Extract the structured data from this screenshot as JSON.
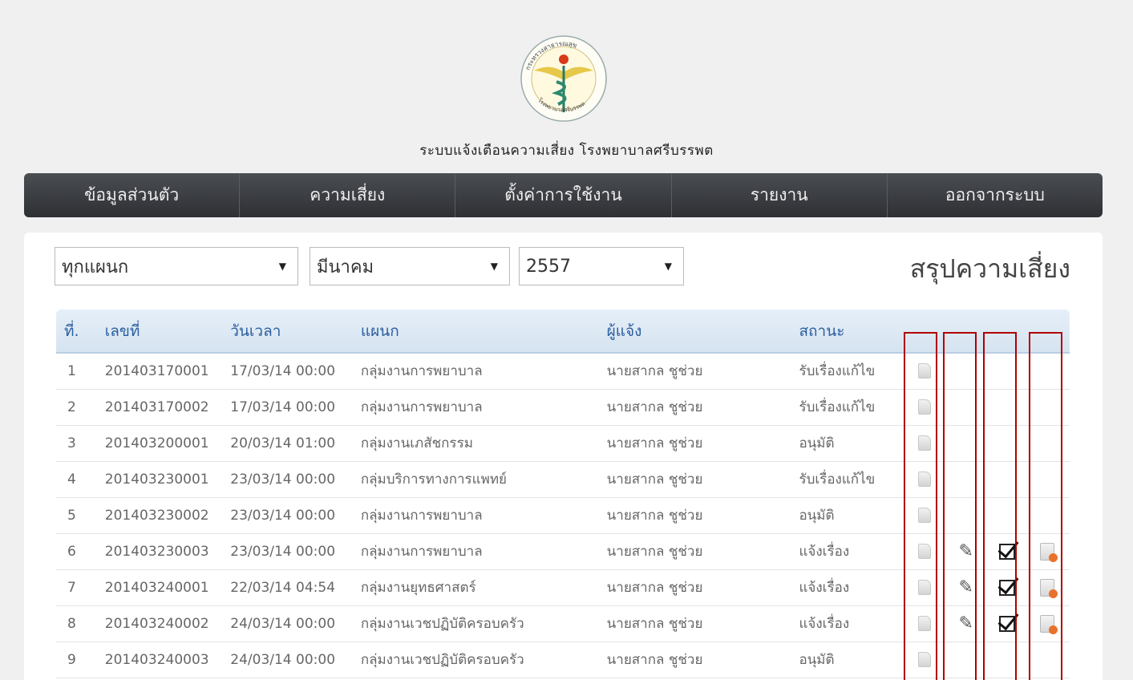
{
  "header": {
    "title": "ระบบแจ้งเตือนความเสี่ยง โรงพยาบาลศรีบรรพต",
    "logo_text_top": "กระทรวงสาธารณสุข",
    "logo_text_bottom": "โรงพยาบาลศรีบรรพต"
  },
  "nav": {
    "items": [
      "ข้อมูลส่วนตัว",
      "ความเสี่ยง",
      "ตั้งค่าการใช้งาน",
      "รายงาน",
      "ออกจากระบบ"
    ]
  },
  "filters": {
    "department": "ทุกแผนก",
    "month": "มีนาคม",
    "year": "2557"
  },
  "panel_title": "สรุปความเสี่ยง",
  "table": {
    "headers": [
      "ที่.",
      "เลขที่",
      "วันเวลา",
      "แผนก",
      "ผู้แจ้ง",
      "สถานะ"
    ],
    "rows": [
      {
        "no": "1",
        "id": "201403170001",
        "datetime": "17/03/14 00:00",
        "dept": "กลุ่มงานการพยาบาล",
        "reporter": "นายสากล ชูช่วย",
        "status": "รับเรื่องแก้ไข"
      },
      {
        "no": "2",
        "id": "201403170002",
        "datetime": "17/03/14 00:00",
        "dept": "กลุ่มงานการพยาบาล",
        "reporter": "นายสากล ชูช่วย",
        "status": "รับเรื่องแก้ไข"
      },
      {
        "no": "3",
        "id": "201403200001",
        "datetime": "20/03/14 01:00",
        "dept": "กลุ่มงานเภสัชกรรม",
        "reporter": "นายสากล ชูช่วย",
        "status": "อนุมัติ"
      },
      {
        "no": "4",
        "id": "201403230001",
        "datetime": "23/03/14 00:00",
        "dept": "กลุ่มบริการทางการแพทย์",
        "reporter": "นายสากล ชูช่วย",
        "status": "รับเรื่องแก้ไข"
      },
      {
        "no": "5",
        "id": "201403230002",
        "datetime": "23/03/14 00:00",
        "dept": "กลุ่มงานการพยาบาล",
        "reporter": "นายสากล ชูช่วย",
        "status": "อนุมัติ"
      },
      {
        "no": "6",
        "id": "201403230003",
        "datetime": "23/03/14 00:00",
        "dept": "กลุ่มงานการพยาบาล",
        "reporter": "นายสากล ชูช่วย",
        "status": "แจ้งเรื่อง"
      },
      {
        "no": "7",
        "id": "201403240001",
        "datetime": "22/03/14 04:54",
        "dept": "กลุ่มงานยุทธศาสตร์",
        "reporter": "นายสากล ชูช่วย",
        "status": "แจ้งเรื่อง"
      },
      {
        "no": "8",
        "id": "201403240002",
        "datetime": "24/03/14 00:00",
        "dept": "กลุ่มงานเวชปฏิบัติครอบครัว",
        "reporter": "นายสากล ชูช่วย",
        "status": "แจ้งเรื่อง"
      },
      {
        "no": "9",
        "id": "201403240003",
        "datetime": "24/03/14 00:00",
        "dept": "กลุ่มงานเวชปฏิบัติครอบครัว",
        "reporter": "นายสากล ชูช่วย",
        "status": "อนุมัติ"
      }
    ]
  },
  "icons": {
    "view": "document-icon",
    "edit": "pencil-icon",
    "approve": "checkbox-check-icon",
    "delete": "document-delete-icon"
  },
  "colors": {
    "header_text": "#2a5ea0",
    "navbar": "#3a3d42",
    "highlight": "#b00000"
  }
}
